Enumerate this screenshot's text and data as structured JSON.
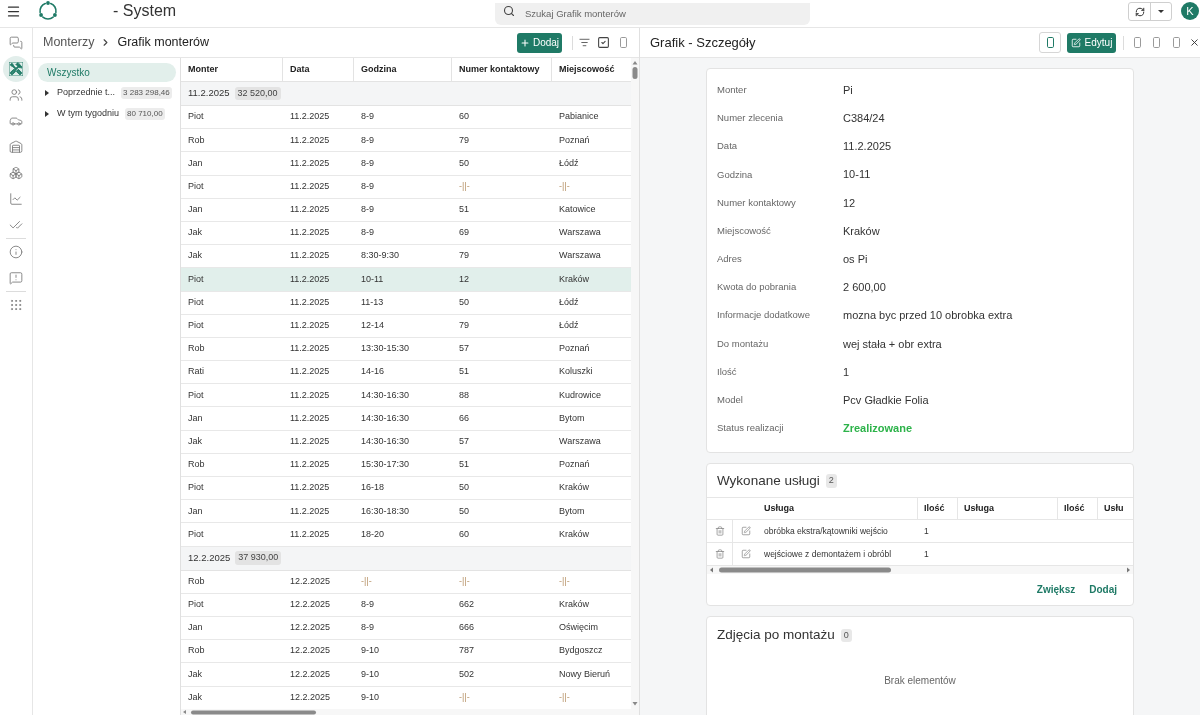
{
  "topbar": {
    "title": "- System",
    "search": {
      "placeholder": "Szukaj Grafik monterów"
    },
    "avatar": "K"
  },
  "nav_rail": {
    "groups": [
      [
        {
          "selected": false
        },
        {
          "selected": true
        },
        {
          "selected": false
        },
        {
          "selected": false
        },
        {
          "selected": false
        },
        {
          "selected": false
        },
        {
          "selected": false
        },
        {
          "selected": false
        }
      ],
      [
        {
          "selected": false
        },
        {
          "selected": false
        }
      ],
      [
        {
          "selected": false
        }
      ]
    ]
  },
  "main": {
    "breadcrumb": [
      "Monterzy",
      "Grafik monterów"
    ],
    "add_button": "Dodaj"
  },
  "tree": {
    "all": {
      "label": "Wszystko",
      "selected": true
    },
    "nodes": [
      {
        "label": "Poprzednie t...",
        "amount": "3 283 298,46",
        "expanded": false,
        "selected": false
      },
      {
        "label": "W tym tygodniu",
        "amount": "80 710,00",
        "expanded": false,
        "selected": false
      }
    ]
  },
  "table": {
    "columns": [
      "Monter",
      "Data",
      "Godzina",
      "Numer kontaktowy",
      "Miejscowość"
    ],
    "groups": [
      {
        "date": "11.2.2025",
        "total": "32 520,00",
        "rows": [
          {
            "cells": [
              "Piot",
              "11.2.2025",
              "8-9",
              "60",
              "Pabianice"
            ],
            "selected": false
          },
          {
            "cells": [
              "Rob",
              "11.2.2025",
              "8-9",
              "79",
              "Poznań"
            ],
            "selected": false
          },
          {
            "cells": [
              "Jan",
              "11.2.2025",
              "8-9",
              "50",
              "Łódź"
            ],
            "selected": false
          },
          {
            "cells": [
              "Piot",
              "11.2.2025",
              "8-9",
              {
                "text": "-||-",
                "kind": "ditto"
              },
              {
                "text": "-||-",
                "kind": "ditto"
              }
            ],
            "selected": false
          },
          {
            "cells": [
              "Jan",
              "11.2.2025",
              "8-9",
              "51",
              "Katowice"
            ],
            "selected": false
          },
          {
            "cells": [
              "Jak",
              "11.2.2025",
              "8-9",
              "69",
              "Warszawa"
            ],
            "selected": false
          },
          {
            "cells": [
              "Jak",
              "11.2.2025",
              "8:30-9:30",
              "79",
              "Warszawa"
            ],
            "selected": false
          },
          {
            "cells": [
              "Piot",
              "11.2.2025",
              "10-11",
              "12",
              "Kraków"
            ],
            "selected": true
          },
          {
            "cells": [
              "Piot",
              "11.2.2025",
              "11-13",
              "50",
              "Łódź"
            ],
            "selected": false
          },
          {
            "cells": [
              "Piot",
              "11.2.2025",
              "12-14",
              "79",
              "Łódź"
            ],
            "selected": false
          },
          {
            "cells": [
              "Rob",
              "11.2.2025",
              "13:30-15:30",
              "57",
              "Poznań"
            ],
            "selected": false
          },
          {
            "cells": [
              "Rati",
              "11.2.2025",
              "14-16",
              "51",
              "Koluszki"
            ],
            "selected": false
          },
          {
            "cells": [
              "Piot",
              "11.2.2025",
              "14:30-16:30",
              "88",
              "Kudrowice"
            ],
            "selected": false
          },
          {
            "cells": [
              "Jan",
              "11.2.2025",
              "14:30-16:30",
              "66",
              "Bytom"
            ],
            "selected": false
          },
          {
            "cells": [
              "Jak",
              "11.2.2025",
              "14:30-16:30",
              "57",
              "Warszawa"
            ],
            "selected": false
          },
          {
            "cells": [
              "Rob",
              "11.2.2025",
              "15:30-17:30",
              "51",
              "Poznań"
            ],
            "selected": false
          },
          {
            "cells": [
              "Piot",
              "11.2.2025",
              "16-18",
              "50",
              "Kraków"
            ],
            "selected": false
          },
          {
            "cells": [
              "Jan",
              "11.2.2025",
              "16:30-18:30",
              "50",
              "Bytom"
            ],
            "selected": false
          },
          {
            "cells": [
              "Piot",
              "11.2.2025",
              "18-20",
              "60",
              "Kraków"
            ],
            "selected": false
          }
        ]
      },
      {
        "date": "12.2.2025",
        "total": "37 930,00",
        "rows": [
          {
            "cells": [
              "Rob",
              "12.2.2025",
              {
                "text": "-||-",
                "kind": "ditto"
              },
              {
                "text": "-||-",
                "kind": "ditto"
              },
              {
                "text": "-||-",
                "kind": "ditto"
              }
            ],
            "selected": false
          },
          {
            "cells": [
              "Piot",
              "12.2.2025",
              "8-9",
              "662",
              "Kraków"
            ],
            "selected": false
          },
          {
            "cells": [
              "Jan",
              "12.2.2025",
              "8-9",
              "666",
              "Oświęcim"
            ],
            "selected": false
          },
          {
            "cells": [
              "Rob",
              "12.2.2025",
              "9-10",
              "787",
              "Bydgoszcz"
            ],
            "selected": false
          },
          {
            "cells": [
              "Jak",
              "12.2.2025",
              "9-10",
              "502",
              "Nowy Bieruń"
            ],
            "selected": false
          },
          {
            "cells": [
              "Jak",
              "12.2.2025",
              "9-10",
              {
                "text": "-||-",
                "kind": "ditto"
              },
              {
                "text": "-||-",
                "kind": "ditto"
              }
            ],
            "selected": false
          }
        ]
      }
    ]
  },
  "details": {
    "title": "Grafik - Szczegóły",
    "edit_button": "Edytuj",
    "fields": [
      {
        "label": "Monter",
        "value": "Pi",
        "kind": "text"
      },
      {
        "label": "Numer zlecenia",
        "value": "C384/24",
        "kind": "text"
      },
      {
        "label": "Data",
        "value": "11.2.2025",
        "kind": "text"
      },
      {
        "label": "Godzina",
        "value": "10-11",
        "kind": "text"
      },
      {
        "label": "Numer kontaktowy",
        "value": "12",
        "kind": "text"
      },
      {
        "label": "Miejscowość",
        "value": "Kraków",
        "kind": "text"
      },
      {
        "label": "Adres",
        "value": "os Pi",
        "kind": "text"
      },
      {
        "label": "Kwota do pobrania",
        "value": "2 600,00",
        "kind": "text"
      },
      {
        "label": "Informacje dodatkowe",
        "value": "mozna byc przed 10 obrobka extra",
        "kind": "text"
      },
      {
        "label": "Do montażu",
        "value": "wej stała + obr extra",
        "kind": "text"
      },
      {
        "label": "Ilość",
        "value": "1",
        "kind": "text"
      },
      {
        "label": "Model",
        "value": "Pcv Gładkie Folia",
        "kind": "text"
      },
      {
        "label": "Status realizacji",
        "value": "Zrealizowane",
        "kind": "status"
      }
    ]
  },
  "services": {
    "title": "Wykonane usługi",
    "count": "2",
    "columns": [
      "Usługa",
      "Ilość",
      "Usługa",
      "Ilość",
      "Usłu"
    ],
    "rows": [
      {
        "cells": [
          "obróbka ekstra/kątowniki wejścio",
          "1"
        ]
      },
      {
        "cells": [
          "wejściowe z demontażem i obróbl",
          "1"
        ]
      }
    ],
    "actions": [
      "Zwiększ",
      "Dodaj"
    ]
  },
  "photos": {
    "title": "Zdjęcia po montażu",
    "count": "0",
    "empty": "Brak elementów"
  }
}
